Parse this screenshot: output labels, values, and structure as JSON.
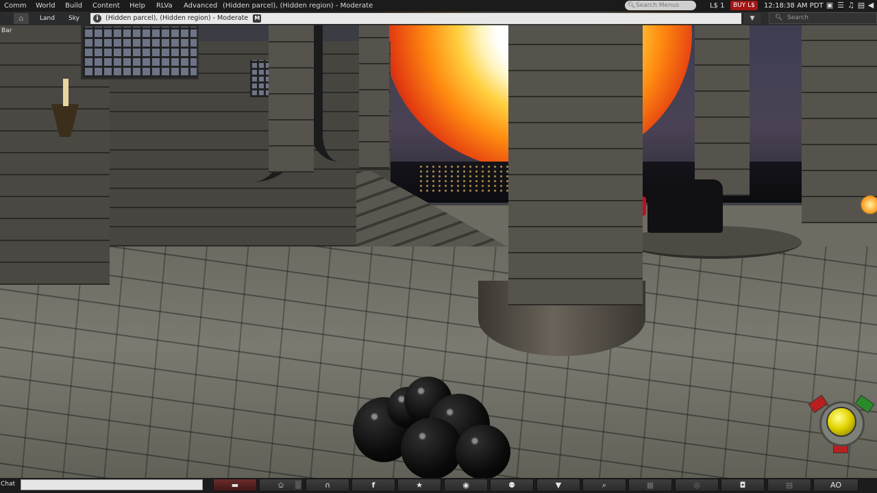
{
  "menubar": {
    "items": [
      "Comm",
      "World",
      "Build",
      "Content",
      "Help",
      "RLVa",
      "Advanced"
    ],
    "location_title": "(Hidden parcel), (Hidden region) - Moderate",
    "search_placeholder": "Search Menus",
    "balance": "L$ 1",
    "buy_label": "BUY L$",
    "time": "12:18:38 AM PDT",
    "tray_icons": [
      "screen-icon",
      "notes-icon",
      "music-icon",
      "media-icon",
      "volume-icon"
    ]
  },
  "navbar": {
    "links": [
      "Land",
      "Sky"
    ],
    "location": "(Hidden parcel), (Hidden region) - Moderate",
    "maturity_badge": "M",
    "search_placeholder": "Search",
    "favorites_label": "Bar"
  },
  "bottombar": {
    "chat_label": "Chat",
    "chat_value": "",
    "ao_label": "AO",
    "buttons": [
      "chat-bubble-icon",
      "microphone-icon",
      "headphones-icon",
      "facebook-icon",
      "walk-icon",
      "eye-icon",
      "people-icon",
      "shirt-icon",
      "search-icon",
      "map-icon",
      "minimap-icon",
      "camera-icon",
      "inventory-icon",
      "ao-button"
    ]
  },
  "colors": {
    "buy_button": "#a31515",
    "active_button": "#6a2b2b",
    "joystick_ball": "#e2d400"
  }
}
